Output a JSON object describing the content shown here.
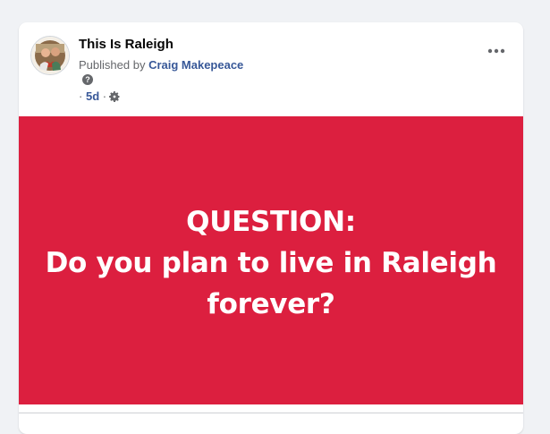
{
  "post": {
    "page_name": "This Is Raleigh",
    "published_by_prefix": "Published by ",
    "author": "Craig Makepeace",
    "help_glyph": "?",
    "meta_separator_1": "·",
    "timestamp": "5d",
    "meta_separator_2": "·",
    "privacy_icon": "gear-icon",
    "more_icon": "ellipsis-icon",
    "avatar_icon": "page-avatar"
  },
  "content": {
    "banner_color": "#dc1f3f",
    "text_color": "#ffffff",
    "line_1": "QUESTION:",
    "line_2": "Do you plan to live in Raleigh",
    "line_3": "forever?"
  }
}
